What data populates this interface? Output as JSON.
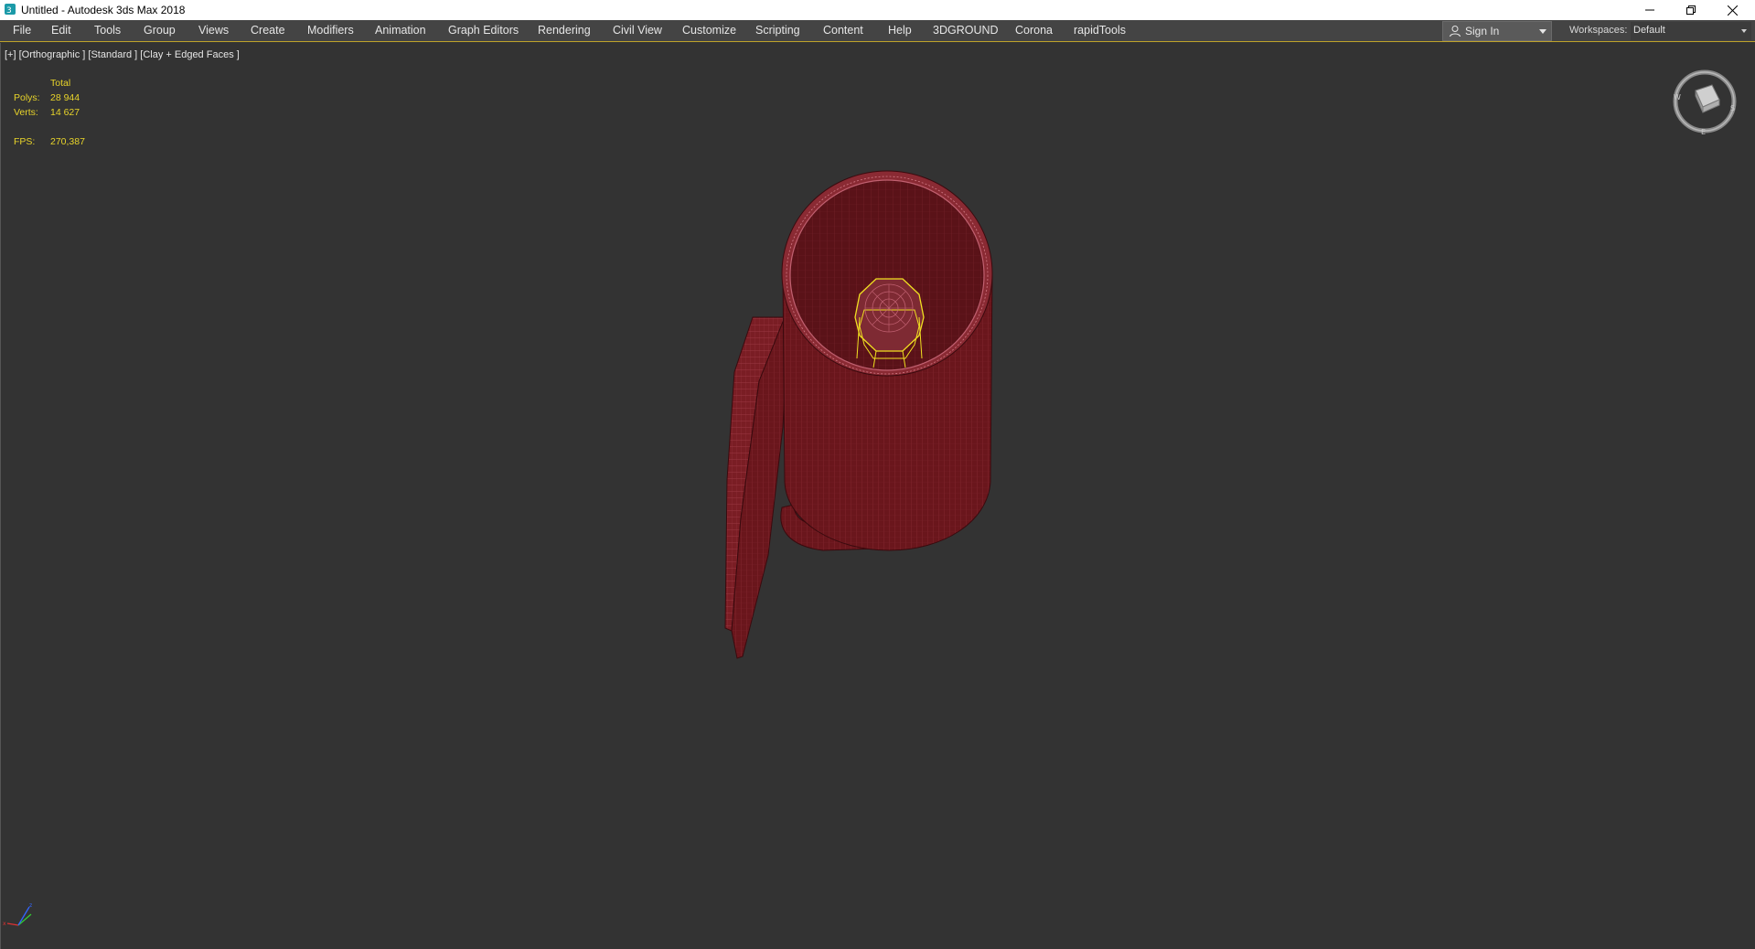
{
  "window": {
    "title": "Untitled - Autodesk 3ds Max 2018",
    "icon": "3ds-max-icon"
  },
  "menubar": {
    "items": [
      "File",
      "Edit",
      "Tools",
      "Group",
      "Views",
      "Create",
      "Modifiers",
      "Animation",
      "Graph Editors",
      "Rendering",
      "Civil View",
      "Customize",
      "Scripting",
      "Content",
      "Help",
      "3DGROUND",
      "Corona",
      "rapidTools"
    ],
    "sign_in": "Sign In",
    "workspaces_label": "Workspaces:",
    "workspace_value": "Default"
  },
  "viewport": {
    "label": "[+] [Orthographic ] [Standard ] [Clay + Edged Faces ]",
    "stats": {
      "total_header": "Total",
      "polys_label": "Polys:",
      "polys_value": "28 944",
      "verts_label": "Verts:",
      "verts_value": "14 627",
      "fps_label": "FPS:",
      "fps_value": "270,387"
    },
    "colors": {
      "background": "#333333",
      "mesh_fill": "#6e1a1f",
      "mesh_edges": "#c05560",
      "selection": "#f0e020",
      "stats_text": "#e8d42a"
    }
  }
}
